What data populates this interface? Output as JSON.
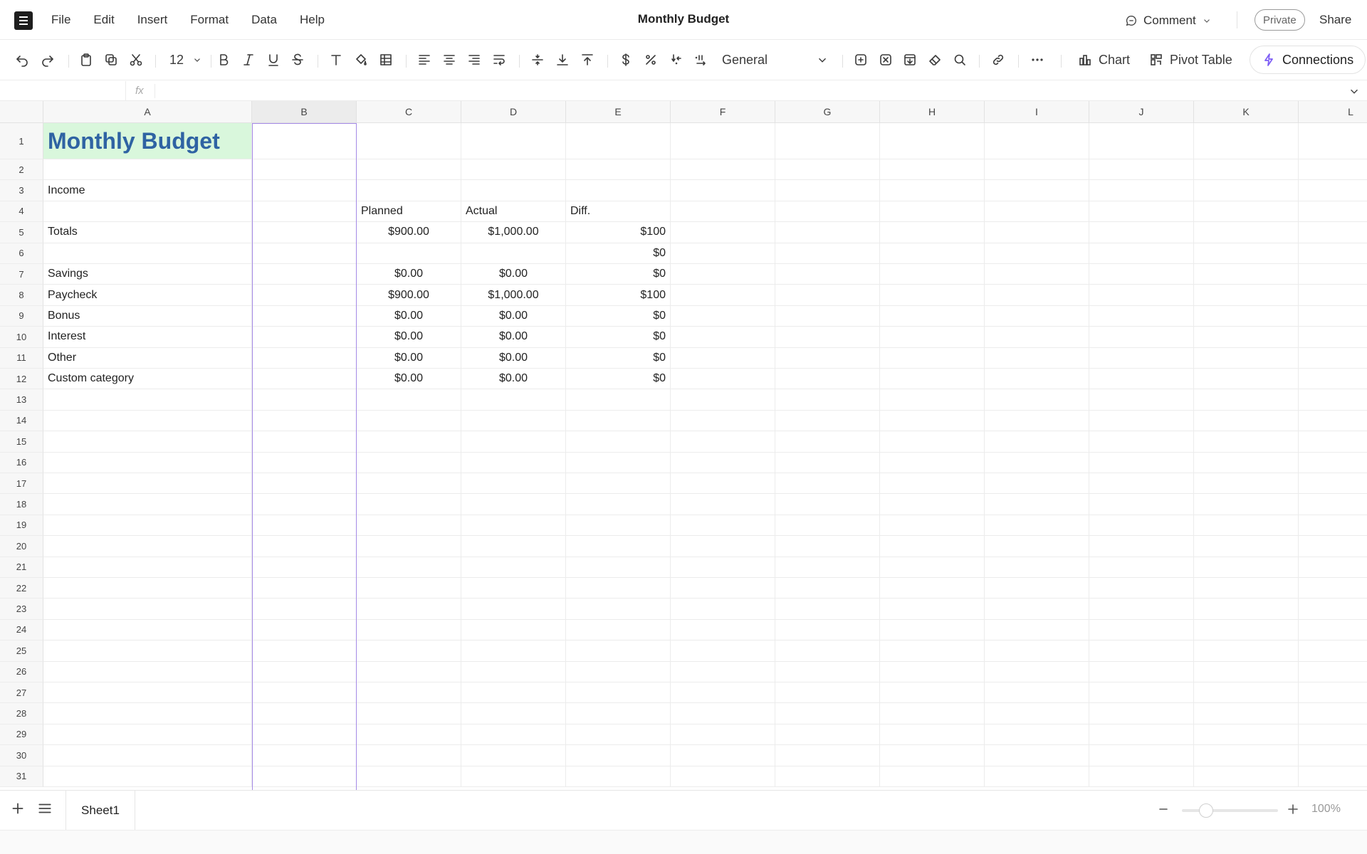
{
  "menubar": {
    "items": [
      "File",
      "Edit",
      "Insert",
      "Format",
      "Data",
      "Help"
    ],
    "title": "Monthly Budget",
    "comment_label": "Comment",
    "private_label": "Private",
    "share_label": "Share"
  },
  "toolbar": {
    "font_size": "12",
    "number_format": "General",
    "chart_label": "Chart",
    "pivot_label": "Pivot Table",
    "connections_label": "Connections",
    "accent_color": "#7c5cf5"
  },
  "formula_bar": {
    "fx_label": "fx",
    "value": ""
  },
  "grid": {
    "columns": [
      "A",
      "B",
      "C",
      "D",
      "E",
      "F",
      "G",
      "H",
      "I",
      "J",
      "K",
      "L"
    ],
    "selected_column": "B",
    "rows": [
      {
        "n": "1",
        "cells": {
          "A": "Monthly Budget"
        }
      },
      {
        "n": "2",
        "cells": {}
      },
      {
        "n": "3",
        "cells": {
          "A": "Income"
        }
      },
      {
        "n": "4",
        "cells": {
          "C": "Planned",
          "D": "Actual",
          "E": "Diff."
        }
      },
      {
        "n": "5",
        "cells": {
          "A": "Totals",
          "C": "$900.00",
          "D": "$1,000.00",
          "E": "$100"
        }
      },
      {
        "n": "6",
        "cells": {
          "E": "$0"
        }
      },
      {
        "n": "7",
        "cells": {
          "A": "Savings",
          "C": "$0.00",
          "D": "$0.00",
          "E": "$0"
        }
      },
      {
        "n": "8",
        "cells": {
          "A": "Paycheck",
          "C": "$900.00",
          "D": "$1,000.00",
          "E": "$100"
        }
      },
      {
        "n": "9",
        "cells": {
          "A": "Bonus",
          "C": "$0.00",
          "D": "$0.00",
          "E": "$0"
        }
      },
      {
        "n": "10",
        "cells": {
          "A": "Interest",
          "C": "$0.00",
          "D": "$0.00",
          "E": "$0"
        }
      },
      {
        "n": "11",
        "cells": {
          "A": "Other",
          "C": "$0.00",
          "D": "$0.00",
          "E": "$0"
        }
      },
      {
        "n": "12",
        "cells": {
          "A": "Custom category",
          "C": "$0.00",
          "D": "$0.00",
          "E": "$0"
        }
      },
      {
        "n": "13",
        "cells": {}
      },
      {
        "n": "14",
        "cells": {}
      },
      {
        "n": "15",
        "cells": {}
      },
      {
        "n": "16",
        "cells": {}
      },
      {
        "n": "17",
        "cells": {}
      },
      {
        "n": "18",
        "cells": {}
      },
      {
        "n": "19",
        "cells": {}
      },
      {
        "n": "20",
        "cells": {}
      },
      {
        "n": "21",
        "cells": {}
      },
      {
        "n": "22",
        "cells": {}
      },
      {
        "n": "23",
        "cells": {}
      },
      {
        "n": "24",
        "cells": {}
      },
      {
        "n": "25",
        "cells": {}
      },
      {
        "n": "26",
        "cells": {}
      },
      {
        "n": "27",
        "cells": {}
      },
      {
        "n": "28",
        "cells": {}
      },
      {
        "n": "29",
        "cells": {}
      },
      {
        "n": "30",
        "cells": {}
      },
      {
        "n": "31",
        "cells": {}
      }
    ],
    "title_fill": "#d9f7dc",
    "title_color": "#2f63a3",
    "selection_color": "#a58ae6"
  },
  "bottombar": {
    "sheet_name": "Sheet1",
    "zoom_label": "100%",
    "zoom_fraction": 0.25
  }
}
